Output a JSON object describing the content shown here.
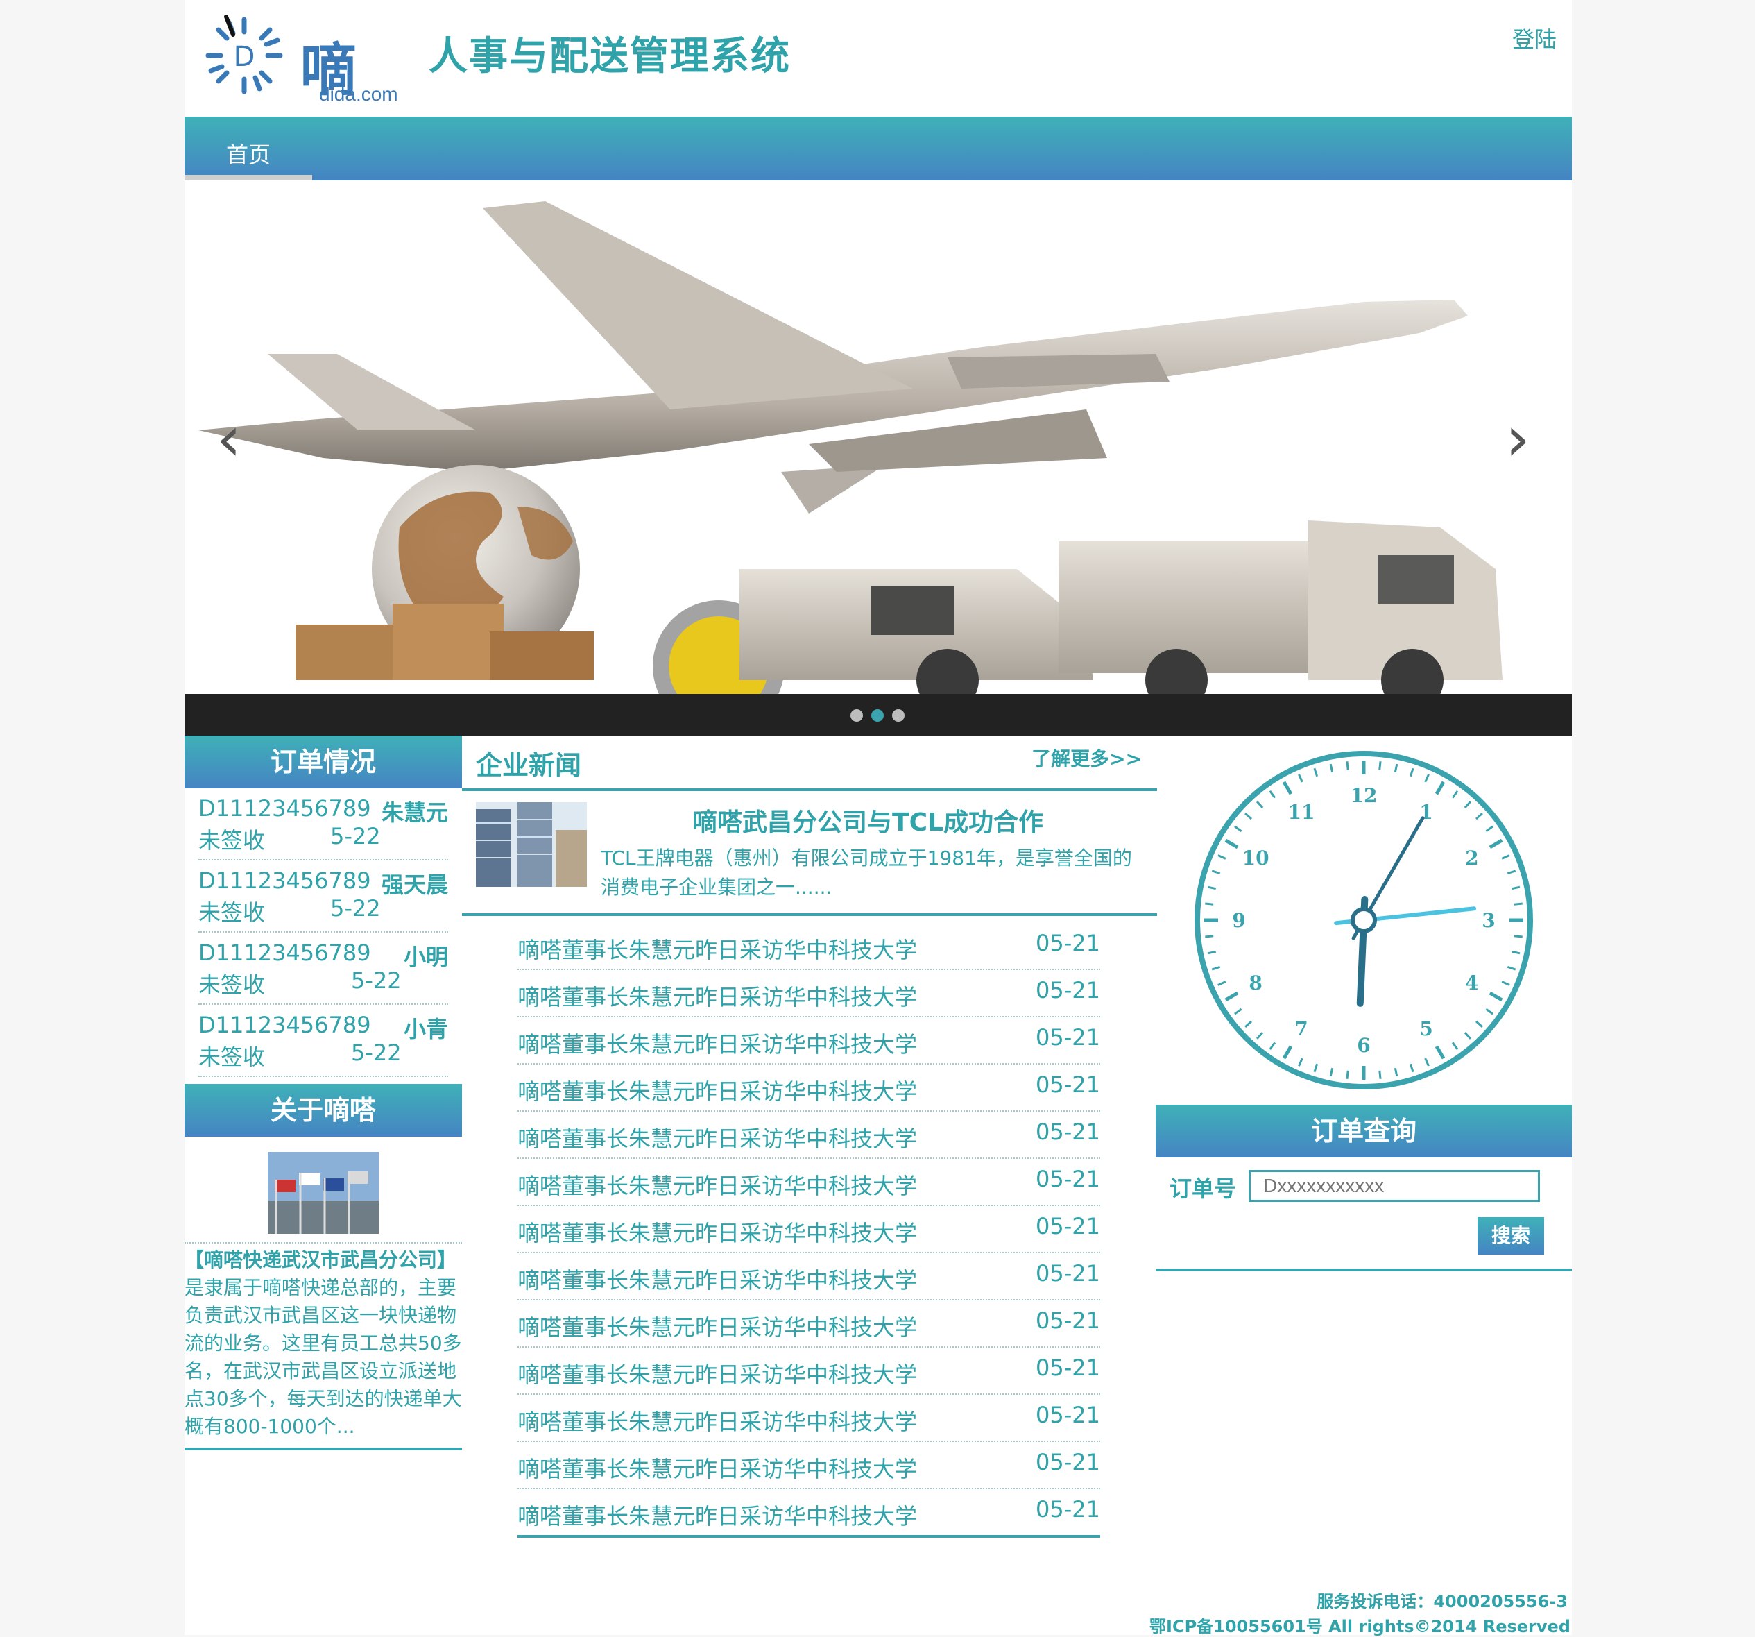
{
  "header": {
    "logo_text": "嘀嗒",
    "logo_sub": "dida.com",
    "site_title": "人事与配送管理系统",
    "login": "登陆"
  },
  "nav": {
    "home": "首页"
  },
  "banner": {
    "prev_icon": "chevron-left-icon",
    "next_icon": "chevron-right-icon",
    "slides": 3,
    "active_slide": 2
  },
  "orders": {
    "title": "订单情况",
    "items": [
      {
        "id": "D11123456789",
        "name": "朱慧元",
        "status": "未签收",
        "date": "5-22"
      },
      {
        "id": "D11123456789",
        "name": "强天晨",
        "status": "未签收",
        "date": "5-22"
      },
      {
        "id": "D11123456789",
        "name": "小明",
        "status": "未签收",
        "date": "5-22"
      },
      {
        "id": "D11123456789",
        "name": "小青",
        "status": "未签收",
        "date": "5-22"
      }
    ]
  },
  "about": {
    "title": "关于嘀嗒",
    "heading": "【嘀嗒快递武汉市武昌分公司】",
    "text": "是隶属于嘀嗒快递总部的，主要负责武汉市武昌区这一块快递物流的业务。这里有员工总共50多名，在武汉市武昌区设立派送地点30多个，每天到达的快递单大概有800-1000个..."
  },
  "news": {
    "title": "企业新闻",
    "more": "了解更多>>",
    "featured": {
      "title": "嘀嗒武昌分公司与TCL成功合作",
      "desc": "TCL王牌电器（惠州）有限公司成立于1981年，是享誉全国的消费电子企业集团之一......"
    },
    "items": [
      {
        "title": "嘀嗒董事长朱慧元昨日采访华中科技大学",
        "date": "05-21"
      },
      {
        "title": "嘀嗒董事长朱慧元昨日采访华中科技大学",
        "date": "05-21"
      },
      {
        "title": "嘀嗒董事长朱慧元昨日采访华中科技大学",
        "date": "05-21"
      },
      {
        "title": "嘀嗒董事长朱慧元昨日采访华中科技大学",
        "date": "05-21"
      },
      {
        "title": "嘀嗒董事长朱慧元昨日采访华中科技大学",
        "date": "05-21"
      },
      {
        "title": "嘀嗒董事长朱慧元昨日采访华中科技大学",
        "date": "05-21"
      },
      {
        "title": "嘀嗒董事长朱慧元昨日采访华中科技大学",
        "date": "05-21"
      },
      {
        "title": "嘀嗒董事长朱慧元昨日采访华中科技大学",
        "date": "05-21"
      },
      {
        "title": "嘀嗒董事长朱慧元昨日采访华中科技大学",
        "date": "05-21"
      },
      {
        "title": "嘀嗒董事长朱慧元昨日采访华中科技大学",
        "date": "05-21"
      },
      {
        "title": "嘀嗒董事长朱慧元昨日采访华中科技大学",
        "date": "05-21"
      },
      {
        "title": "嘀嗒董事长朱慧元昨日采访华中科技大学",
        "date": "05-21"
      },
      {
        "title": "嘀嗒董事长朱慧元昨日采访华中科技大学",
        "date": "05-21"
      }
    ]
  },
  "clock": {
    "numbers": [
      "12",
      "1",
      "2",
      "3",
      "4",
      "5",
      "6",
      "7",
      "8",
      "9",
      "10",
      "11"
    ],
    "hour": 6,
    "minute": 5,
    "second": 14
  },
  "query": {
    "title": "订单查询",
    "label": "订单号",
    "placeholder": "Dxxxxxxxxxxx",
    "button": "搜索"
  },
  "footer": {
    "phone": "服务投诉电话：4000205556-3",
    "copyright": "鄂ICP备10055601号 All rights©2014 Reserved"
  },
  "colors": {
    "accent": "#3aa3ad",
    "nav_top": "#3fb1b8",
    "nav_bottom": "#4584c3",
    "logo": "#3a79b8"
  }
}
